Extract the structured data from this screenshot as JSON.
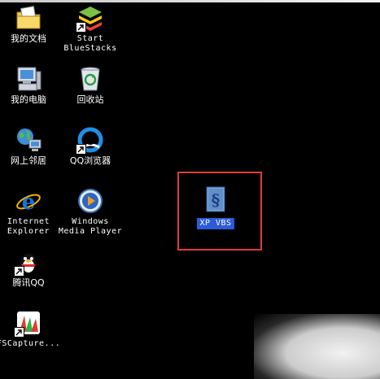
{
  "desktop": {
    "icons": [
      {
        "label": "我的文档",
        "icon": "my-documents-icon",
        "shortcut": false
      },
      {
        "label": "Start\nBlueStacks",
        "icon": "bluestacks-icon",
        "shortcut": true
      },
      {
        "label": "我的电脑",
        "icon": "my-computer-icon",
        "shortcut": false
      },
      {
        "label": "回收站",
        "icon": "recycle-bin-icon",
        "shortcut": false
      },
      {
        "label": "网上邻居",
        "icon": "network-places-icon",
        "shortcut": false
      },
      {
        "label": "QQ浏览器",
        "icon": "qq-browser-icon",
        "shortcut": true
      },
      {
        "label": "Internet\nExplorer",
        "icon": "internet-explorer-icon",
        "shortcut": false
      },
      {
        "label": "Windows\nMedia Player",
        "icon": "windows-media-player-icon",
        "shortcut": false
      },
      {
        "label": "腾讯QQ",
        "icon": "tencent-qq-icon",
        "shortcut": true
      },
      {
        "label": "FSCapture...",
        "icon": "fscapture-icon",
        "shortcut": true
      },
      {
        "label": "XP VBS",
        "icon": "vbs-script-icon",
        "shortcut": false,
        "selected": true
      }
    ]
  },
  "colors": {
    "desktop_background": "#000000",
    "label_text": "#ffffff",
    "selection_highlight": "#2b5bd6",
    "annotation_box": "#e03a3a"
  }
}
